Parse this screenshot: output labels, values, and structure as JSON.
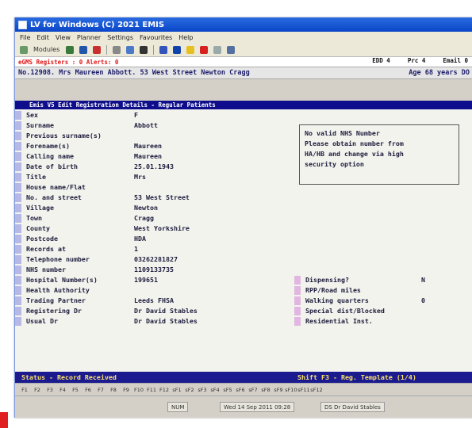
{
  "window": {
    "title": "LV for Windows (C) 2021 EMIS"
  },
  "menu": [
    "File",
    "Edit",
    "View",
    "Planner",
    "Settings",
    "Favourites",
    "Help"
  ],
  "toolbar": {
    "modules_label": "Modules"
  },
  "alerts": {
    "left": "eGMS Registers : 0  Alerts: 0",
    "edd": "EDD 4",
    "prc": "Prc 4",
    "email": "Email 0"
  },
  "patient": {
    "banner": "No.12908. Mrs Maureen Abbott. 53 West Street Newton Cragg",
    "age": "Age 68 years DO"
  },
  "screen_title": "Emis V5 Edit Registration Details - Regular Patients",
  "fields": [
    {
      "label": "Sex",
      "value": "F"
    },
    {
      "label": "Surname",
      "value": "Abbott"
    },
    {
      "label": "Previous surname(s)",
      "value": ""
    },
    {
      "label": "Forename(s)",
      "value": "Maureen"
    },
    {
      "label": "Calling name",
      "value": "Maureen"
    },
    {
      "label": "Date of birth",
      "value": "25.01.1943"
    },
    {
      "label": "Title",
      "value": "Mrs"
    },
    {
      "label": "House name/Flat",
      "value": ""
    },
    {
      "label": "No. and street",
      "value": "53 West Street"
    },
    {
      "label": "Village",
      "value": "Newton"
    },
    {
      "label": "Town",
      "value": "Cragg"
    },
    {
      "label": "County",
      "value": "West Yorkshire"
    },
    {
      "label": "Postcode",
      "value": "HDA"
    },
    {
      "label": "Records at",
      "value": "1"
    },
    {
      "label": "Telephone number",
      "value": "03262281827"
    },
    {
      "label": "NHS number",
      "value": "1109133735"
    },
    {
      "label": "Hospital Number(s)",
      "value": "199651"
    },
    {
      "label": "Health Authority",
      "value": ""
    },
    {
      "label": "Trading Partner",
      "value": "Leeds FHSA"
    },
    {
      "label": "Registering Dr",
      "value": "Dr David Stables"
    },
    {
      "label": "Usual Dr",
      "value": "Dr David Stables"
    }
  ],
  "message_lines": [
    "No valid NHS Number",
    "Please obtain number from",
    "HA/HB and change via high",
    "security option"
  ],
  "right_fields": [
    {
      "label": "Dispensing?",
      "value": "N"
    },
    {
      "label": "RPP/Road miles",
      "value": ""
    },
    {
      "label": "Walking quarters",
      "value": "0"
    },
    {
      "label": "Special dist/Blocked",
      "value": ""
    },
    {
      "label": "Residential Inst.",
      "value": ""
    }
  ],
  "status_line": {
    "left": "Status - Record Received",
    "right": "Shift F3 - Reg. Template  (1/4)"
  },
  "fkeys": [
    "F1",
    "F2",
    "F3",
    "F4",
    "F5",
    "F6",
    "F7",
    "F8",
    "F9",
    "F10",
    "F11",
    "F12",
    "sF1",
    "sF2",
    "sF3",
    "sF4",
    "sF5",
    "sF6",
    "sF7",
    "sF8",
    "sF9",
    "sF10",
    "sF11",
    "sF12"
  ],
  "statusbar": {
    "num": "NUM",
    "datetime": "Wed 14 Sep 2011 09:28",
    "user": "DS Dr David Stables"
  }
}
